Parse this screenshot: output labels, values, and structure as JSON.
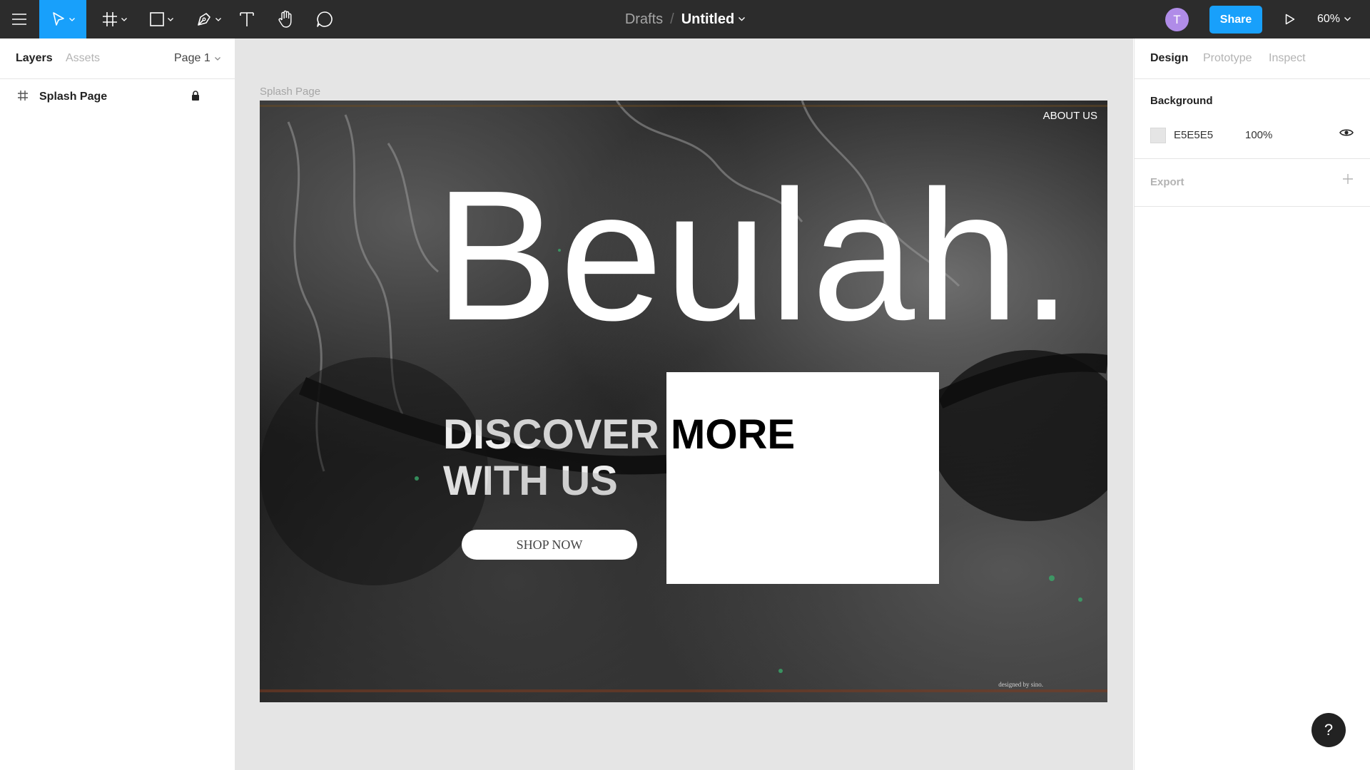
{
  "toolbar": {
    "breadcrumb_root": "Drafts",
    "breadcrumb_separator": "/",
    "file_title": "Untitled",
    "avatar_initial": "T",
    "share_label": "Share",
    "zoom_label": "60%",
    "accent_color": "#18a0fb"
  },
  "left_panel": {
    "tabs": [
      "Layers",
      "Assets"
    ],
    "page_selector": "Page 1",
    "layers": [
      {
        "name": "Splash Page",
        "locked": true
      }
    ]
  },
  "canvas": {
    "frame_label": "Splash Page",
    "frame": {
      "about_link": "ABOUT US",
      "hero_title": "Beulah.",
      "headline_line1": "DISCOVER MORE",
      "headline_line2": "WITH US",
      "cta_label": "SHOP NOW",
      "credit": "designed by sino."
    }
  },
  "right_panel": {
    "tabs": [
      "Design",
      "Prototype",
      "Inspect"
    ],
    "background_title": "Background",
    "background_hex": "E5E5E5",
    "background_opacity": "100%",
    "export_title": "Export"
  },
  "help_label": "?"
}
